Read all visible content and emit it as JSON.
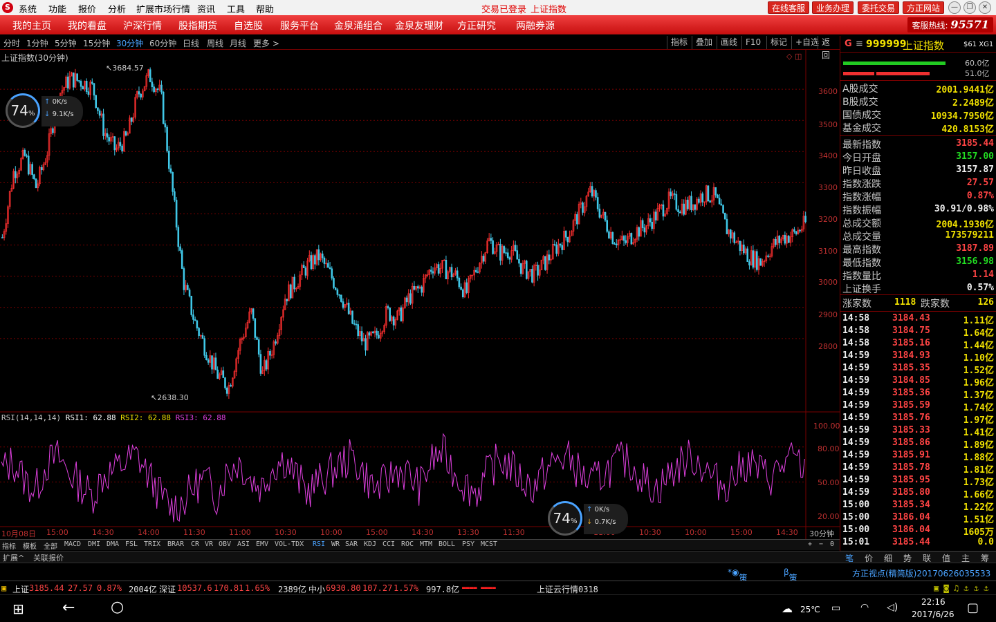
{
  "menu": {
    "items": [
      "系统",
      "功能",
      "报价",
      "分析",
      "扩展市场行情",
      "资讯",
      "工具",
      "帮助"
    ],
    "status": "交易已登录",
    "status_index": "上证指数",
    "right_buttons": [
      "在线客服",
      "业务办理",
      "委托交易",
      "方正网站"
    ]
  },
  "nav": {
    "items": [
      "我的主页",
      "我的看盘",
      "沪深行情",
      "股指期货",
      "自选股",
      "服务平台",
      "金泉涌组合",
      "金泉友理财",
      "方正研究",
      "两融券源"
    ],
    "hotline_label": "客服热线:",
    "hotline_number": "95571"
  },
  "period_bar": {
    "items": [
      "分时",
      "1分钟",
      "5分钟",
      "15分钟",
      "30分钟",
      "60分钟",
      "日线",
      "周线",
      "月线",
      "更多 >"
    ],
    "selected": "30分钟",
    "tools": [
      "指标",
      "叠加",
      "画线",
      "F10",
      "标记",
      "+自选",
      "返回"
    ]
  },
  "chart": {
    "title": "上证指数(30分钟)",
    "high_label": "3684.57",
    "low_label": "2638.30",
    "y_ticks": [
      "3600",
      "3500",
      "3400",
      "3300",
      "3200",
      "3100",
      "3000",
      "2900",
      "2800"
    ],
    "rsi_y_ticks": [
      "100.00",
      "80.00",
      "50.00",
      "20.00"
    ],
    "x_ticks": [
      "10月08日",
      "15:00",
      "14:30",
      "14:00",
      "11:30",
      "11:00",
      "10:30",
      "10:00",
      "15:00",
      "14:30",
      "13:30",
      "11:30",
      "11:00",
      "10:30",
      "10:00",
      "15:00",
      "14:30",
      "13:30",
      "30分钟"
    ],
    "rsi_label": {
      "name": "RSI(14,14,14)",
      "rsi1": "RSI1: 62.88",
      "rsi2": "RSI2: 62.88",
      "rsi3": "RSI3: 62.88"
    },
    "color_up": "#ff3030",
    "color_down": "#40c8e8",
    "color_rsi": "#e040e0",
    "color_grid": "#7a0000"
  },
  "chart_data": {
    "type": "line",
    "title": "上证指数(30分钟)",
    "ylim": [
      2600,
      3720
    ],
    "series": [
      {
        "name": "上证指数",
        "values": [
          3140,
          3350,
          3400,
          3300,
          3420,
          3600,
          3650,
          3640,
          3620,
          3480,
          3420,
          3460,
          3600,
          3660,
          3600,
          3300,
          3000,
          2870,
          2780,
          2700,
          2660,
          2800,
          2900,
          2700,
          2800,
          2950,
          3000,
          3050,
          3080,
          3020,
          2950,
          2860,
          2800,
          2820,
          2900,
          2880,
          2950,
          2980,
          3050,
          3040,
          3020,
          2960,
          3050,
          3130,
          3090,
          3100,
          3040,
          3020,
          3060,
          3110,
          3150,
          3220,
          3290,
          3210,
          3140,
          3120,
          3160,
          3180,
          3220,
          3260,
          3240,
          3250,
          3280,
          3270,
          3170,
          3120,
          3080,
          3060,
          3110,
          3140,
          3150,
          3185
        ]
      },
      {
        "name": "RSI",
        "values": [
          62,
          70,
          55,
          45,
          68,
          74,
          60,
          50,
          40,
          58,
          62,
          70,
          75,
          58,
          42,
          30,
          35,
          48,
          55,
          40,
          62,
          70,
          55,
          48,
          66,
          72,
          58,
          44,
          52,
          60,
          68,
          74,
          60,
          46,
          52,
          64,
          58,
          48,
          70,
          78,
          62,
          50,
          44,
          60,
          72,
          66,
          54,
          48,
          60,
          70,
          74,
          62,
          50,
          58,
          66,
          72,
          64,
          52,
          46,
          58,
          68,
          74,
          66,
          54,
          50,
          60,
          70,
          62,
          56,
          66,
          72,
          63
        ]
      }
    ]
  },
  "meters": {
    "top": {
      "percent": "74",
      "up": "0K/s",
      "down": "9.1K/s"
    },
    "bottom": {
      "percent": "74",
      "up": "0K/s",
      "down": "0.7K/s"
    }
  },
  "indicator_tabs": [
    "指标",
    "模板",
    "全部",
    "MACD",
    "DMI",
    "DMA",
    "FSL",
    "TRIX",
    "BRAR",
    "CR",
    "VR",
    "OBV",
    "ASI",
    "EMV",
    "VOL-TDX",
    "RSI",
    "WR",
    "SAR",
    "KDJ",
    "CCI",
    "ROC",
    "MTM",
    "BOLL",
    "PSY",
    "MCST"
  ],
  "indicator_selected": "RSI",
  "ext_tabs": [
    "扩展^",
    "关联报价"
  ],
  "zoom_controls": [
    "+",
    "−",
    "0"
  ],
  "right_panel": {
    "code": "999999",
    "name": "上证指数",
    "tag": "$61 XG1",
    "bar1_pct": "60.0亿",
    "bar2_pct": "51.0亿",
    "volume_rows": [
      {
        "label": "A股成交",
        "value": "2001.9441亿"
      },
      {
        "label": "B股成交",
        "value": "2.2489亿"
      },
      {
        "label": "国债成交",
        "value": "10934.7950亿"
      },
      {
        "label": "基金成交",
        "value": "420.8153亿"
      }
    ],
    "quote_rows": [
      {
        "label": "最新指数",
        "value": "3185.44",
        "color": "red"
      },
      {
        "label": "今日开盘",
        "value": "3157.00",
        "color": "green"
      },
      {
        "label": "昨日收盘",
        "value": "3157.87",
        "color": "white"
      },
      {
        "label": "指数涨跌",
        "value": "27.57",
        "color": "red"
      },
      {
        "label": "指数涨幅",
        "value": "0.87%",
        "color": "red"
      },
      {
        "label": "指数振幅",
        "value": "30.91/0.98%",
        "color": "white"
      },
      {
        "label": "总成交额",
        "value": "2004.1930亿",
        "color": "yellow"
      },
      {
        "label": "总成交量",
        "value": "173579211",
        "color": "yellow"
      },
      {
        "label": "最高指数",
        "value": "3187.89",
        "color": "red"
      },
      {
        "label": "最低指数",
        "value": "3156.98",
        "color": "green"
      },
      {
        "label": "指数量比",
        "value": "1.14",
        "color": "red"
      },
      {
        "label": "上证换手",
        "value": "0.57%",
        "color": "white"
      }
    ],
    "rise_label": "涨家数",
    "rise_value": "1118",
    "fall_label": "跌家数",
    "fall_value": "126",
    "ticks": [
      {
        "t": "14:58",
        "p": "3184.43",
        "v": "1.11亿"
      },
      {
        "t": "14:58",
        "p": "3184.75",
        "v": "1.64亿"
      },
      {
        "t": "14:58",
        "p": "3185.16",
        "v": "1.44亿"
      },
      {
        "t": "14:59",
        "p": "3184.93",
        "v": "1.10亿"
      },
      {
        "t": "14:59",
        "p": "3185.35",
        "v": "1.52亿"
      },
      {
        "t": "14:59",
        "p": "3184.85",
        "v": "1.96亿"
      },
      {
        "t": "14:59",
        "p": "3185.36",
        "v": "1.37亿"
      },
      {
        "t": "14:59",
        "p": "3185.59",
        "v": "1.74亿"
      },
      {
        "t": "14:59",
        "p": "3185.76",
        "v": "1.97亿"
      },
      {
        "t": "14:59",
        "p": "3185.33",
        "v": "1.41亿"
      },
      {
        "t": "14:59",
        "p": "3185.86",
        "v": "1.89亿"
      },
      {
        "t": "14:59",
        "p": "3185.91",
        "v": "1.88亿"
      },
      {
        "t": "14:59",
        "p": "3185.78",
        "v": "1.81亿"
      },
      {
        "t": "14:59",
        "p": "3185.95",
        "v": "1.73亿"
      },
      {
        "t": "14:59",
        "p": "3185.80",
        "v": "1.66亿"
      },
      {
        "t": "15:00",
        "p": "3185.34",
        "v": "1.22亿"
      },
      {
        "t": "15:00",
        "p": "3186.04",
        "v": "1.51亿"
      },
      {
        "t": "15:00",
        "p": "3186.04",
        "v": "1605万"
      },
      {
        "t": "15:01",
        "p": "3185.44",
        "v": "0.0"
      }
    ],
    "tabs": [
      "笔",
      "价",
      "细",
      "势",
      "联",
      "值",
      "主",
      "筹"
    ]
  },
  "links": {
    "strategy_select": "策略选股",
    "strategy_op": "策略操作",
    "view": "方正视点(精简版)20170626035533"
  },
  "status": {
    "sh_label": "上证",
    "sh_value": "3185.44",
    "sh_change": "27.57",
    "sh_pct": "0.87%",
    "sh_amount": "2004亿",
    "sz_label": "深证",
    "sz_value": "10537.6",
    "sz_change": "170.81",
    "sz_pct": "1.65%",
    "sz_amount": "2389亿",
    "zx_label": "中小",
    "zx_value": "6930.80",
    "zx_change": "107.27",
    "zx_pct": "1.57%",
    "zx_amount": "997.8亿",
    "cloud": "上证云行情0318"
  },
  "taskbar": {
    "temp": "25℃",
    "time": "22:16",
    "date": "2017/6/26"
  }
}
